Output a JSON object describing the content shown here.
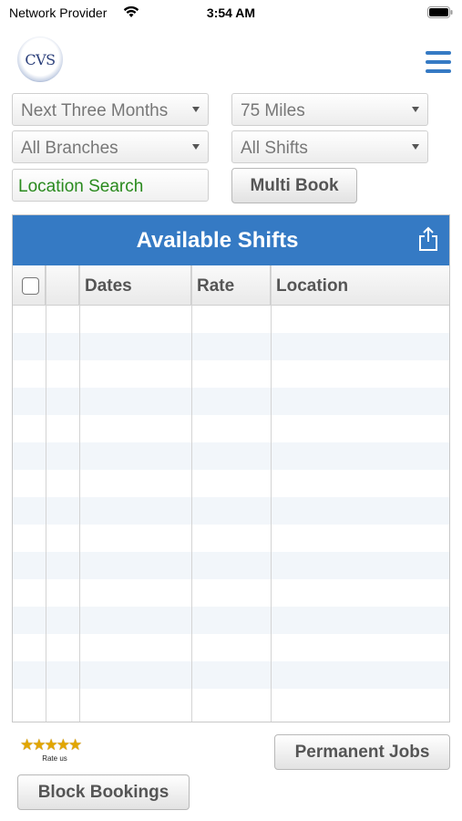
{
  "status_bar": {
    "carrier": "Network Provider",
    "time": "3:54 AM",
    "wifi_icon": "wifi-icon",
    "battery_icon": "battery-icon"
  },
  "header": {
    "logo_text": "CVS",
    "menu_icon": "hamburger-menu-icon"
  },
  "filters": {
    "period": "Next Three Months",
    "distance": "75 Miles",
    "branch": "All Branches",
    "shift": "All Shifts",
    "location_placeholder": "Location Search",
    "multi_book_label": "Multi Book"
  },
  "shifts_panel": {
    "title": "Available Shifts",
    "export_icon": "share-icon",
    "columns": [
      "",
      "",
      "Dates",
      "Rate",
      "Location"
    ],
    "rows": []
  },
  "footer": {
    "stars": "★★★★★",
    "rate_label": "Rate us",
    "permanent_jobs_label": "Permanent Jobs",
    "block_bookings_label": "Block Bookings"
  },
  "colors": {
    "accent": "#357ac4",
    "location_text": "#2a8a1e",
    "star": "#e2a600"
  }
}
